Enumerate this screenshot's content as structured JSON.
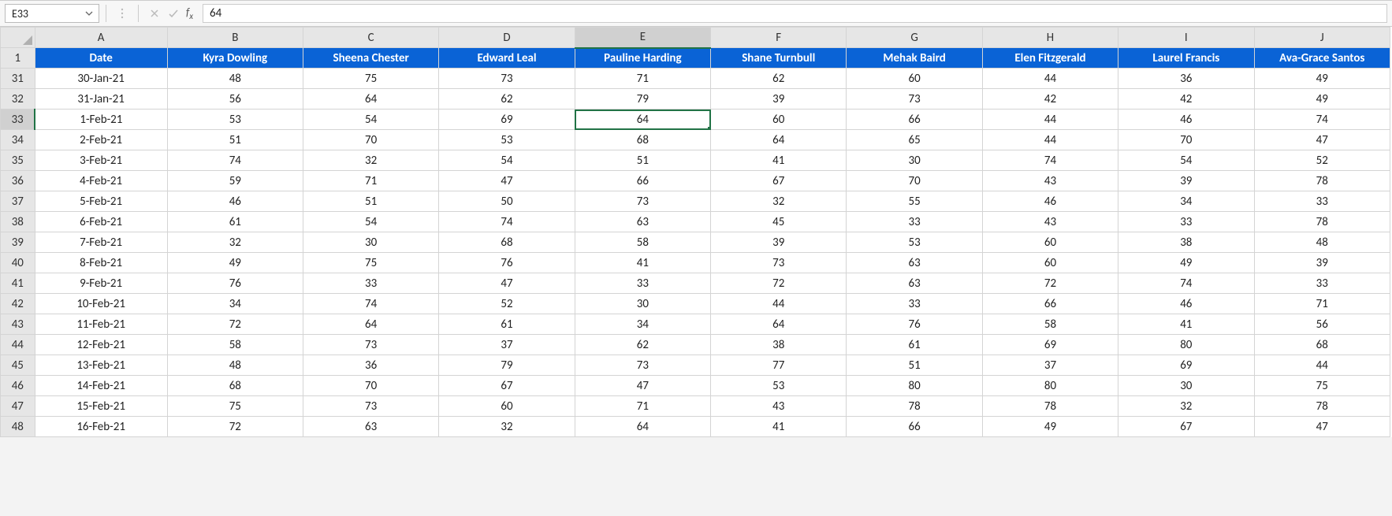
{
  "formula_bar": {
    "name_box": "E33",
    "formula_value": "64"
  },
  "columns": [
    "A",
    "B",
    "C",
    "D",
    "E",
    "F",
    "G",
    "H",
    "I",
    "J"
  ],
  "selected_column_index": 4,
  "selected_row_number": 33,
  "header_row_number": 1,
  "headers": [
    "Date",
    "Kyra Dowling",
    "Sheena Chester",
    "Edward Leal",
    "Pauline Harding",
    "Shane Turnbull",
    "Mehak Baird",
    "Elen Fitzgerald",
    "Laurel Francis",
    "Ava-Grace Santos"
  ],
  "rows": [
    {
      "n": 31,
      "cells": [
        "30-Jan-21",
        "48",
        "75",
        "73",
        "71",
        "62",
        "60",
        "44",
        "36",
        "49"
      ]
    },
    {
      "n": 32,
      "cells": [
        "31-Jan-21",
        "56",
        "64",
        "62",
        "79",
        "39",
        "73",
        "42",
        "42",
        "49"
      ]
    },
    {
      "n": 33,
      "cells": [
        "1-Feb-21",
        "53",
        "54",
        "69",
        "64",
        "60",
        "66",
        "44",
        "46",
        "74"
      ]
    },
    {
      "n": 34,
      "cells": [
        "2-Feb-21",
        "51",
        "70",
        "53",
        "68",
        "64",
        "65",
        "44",
        "70",
        "47"
      ]
    },
    {
      "n": 35,
      "cells": [
        "3-Feb-21",
        "74",
        "32",
        "54",
        "51",
        "41",
        "30",
        "74",
        "54",
        "52"
      ]
    },
    {
      "n": 36,
      "cells": [
        "4-Feb-21",
        "59",
        "71",
        "47",
        "66",
        "67",
        "70",
        "43",
        "39",
        "78"
      ]
    },
    {
      "n": 37,
      "cells": [
        "5-Feb-21",
        "46",
        "51",
        "50",
        "73",
        "32",
        "55",
        "46",
        "34",
        "33"
      ]
    },
    {
      "n": 38,
      "cells": [
        "6-Feb-21",
        "61",
        "54",
        "74",
        "63",
        "45",
        "33",
        "43",
        "33",
        "78"
      ]
    },
    {
      "n": 39,
      "cells": [
        "7-Feb-21",
        "32",
        "30",
        "68",
        "58",
        "39",
        "53",
        "60",
        "38",
        "48"
      ]
    },
    {
      "n": 40,
      "cells": [
        "8-Feb-21",
        "49",
        "75",
        "76",
        "41",
        "73",
        "63",
        "60",
        "49",
        "39"
      ]
    },
    {
      "n": 41,
      "cells": [
        "9-Feb-21",
        "76",
        "33",
        "47",
        "33",
        "72",
        "63",
        "72",
        "74",
        "33"
      ]
    },
    {
      "n": 42,
      "cells": [
        "10-Feb-21",
        "34",
        "74",
        "52",
        "30",
        "44",
        "33",
        "66",
        "46",
        "71"
      ]
    },
    {
      "n": 43,
      "cells": [
        "11-Feb-21",
        "72",
        "64",
        "61",
        "34",
        "64",
        "76",
        "58",
        "41",
        "56"
      ]
    },
    {
      "n": 44,
      "cells": [
        "12-Feb-21",
        "58",
        "73",
        "37",
        "62",
        "38",
        "61",
        "69",
        "80",
        "68"
      ]
    },
    {
      "n": 45,
      "cells": [
        "13-Feb-21",
        "48",
        "36",
        "79",
        "73",
        "77",
        "51",
        "37",
        "69",
        "44"
      ]
    },
    {
      "n": 46,
      "cells": [
        "14-Feb-21",
        "68",
        "70",
        "67",
        "47",
        "53",
        "80",
        "80",
        "30",
        "75"
      ]
    },
    {
      "n": 47,
      "cells": [
        "15-Feb-21",
        "75",
        "73",
        "60",
        "71",
        "43",
        "78",
        "78",
        "32",
        "78"
      ]
    },
    {
      "n": 48,
      "cells": [
        "16-Feb-21",
        "72",
        "63",
        "32",
        "64",
        "41",
        "66",
        "49",
        "67",
        "47"
      ]
    }
  ],
  "active_cell": {
    "col_index": 4,
    "row_number": 33
  }
}
